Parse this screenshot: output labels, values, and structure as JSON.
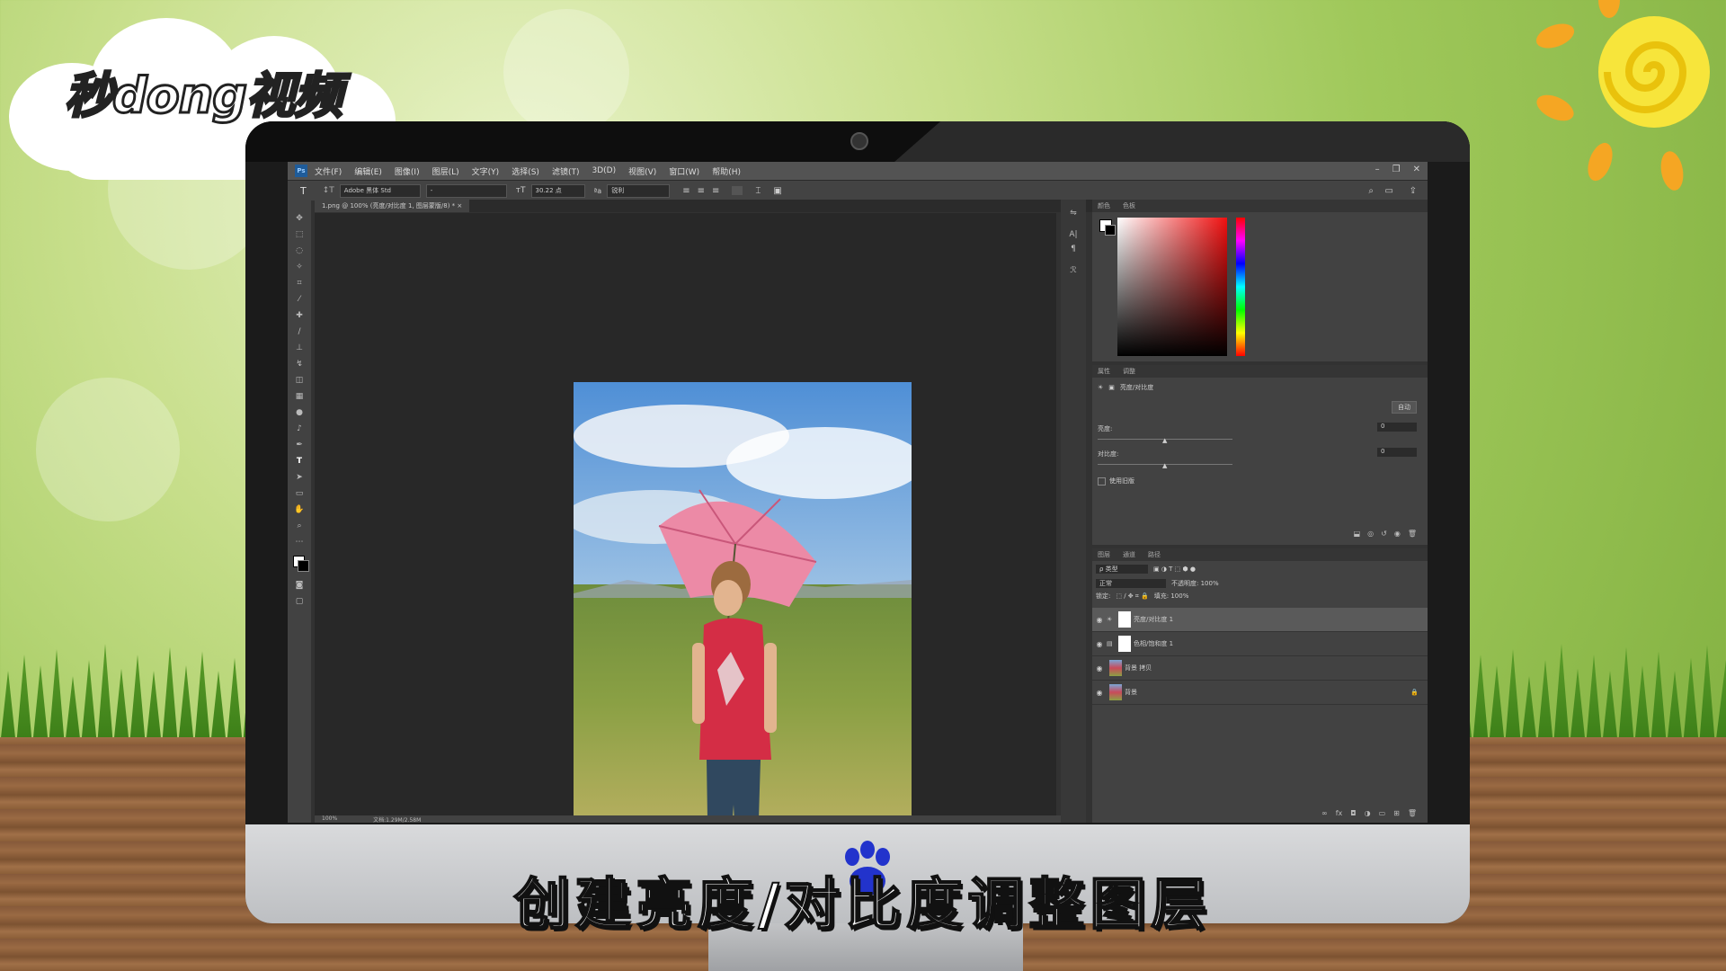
{
  "brand": {
    "logo_text": "秒dong视频"
  },
  "caption": "创建亮度/对比度调整图层",
  "app": {
    "menu": [
      "文件(F)",
      "编辑(E)",
      "图像(I)",
      "图层(L)",
      "文字(Y)",
      "选择(S)",
      "滤镜(T)",
      "3D(D)",
      "视图(V)",
      "窗口(W)",
      "帮助(H)"
    ],
    "options": {
      "font_family": "Adobe 黑体 Std",
      "font_style": "-",
      "font_size": "30.22 点",
      "antialias": "锐利"
    },
    "doc_tab": "1.png @ 100% (亮度/对比度 1, 图层蒙版/8) * ×",
    "status": {
      "zoom": "100%",
      "doc_size": "文档:1.29M/2.58M"
    }
  },
  "color_panel": {
    "tabs": [
      "颜色",
      "色板"
    ]
  },
  "properties": {
    "tabs": [
      "属性",
      "调整"
    ],
    "title": "亮度/对比度",
    "auto_label": "自动",
    "brightness_label": "亮度:",
    "brightness_value": "0",
    "contrast_label": "对比度:",
    "contrast_value": "0",
    "legacy_label": "使用旧版"
  },
  "layers_panel": {
    "tabs": [
      "图层",
      "通道",
      "路径"
    ],
    "filter_label": "ρ 类型",
    "blend_mode": "正常",
    "opacity_label": "不透明度: 100%",
    "lock_label": "锁定:",
    "fill_label": "填充: 100%",
    "layers": [
      {
        "name": "亮度/对比度 1",
        "selected": true
      },
      {
        "name": "色相/饱和度 1",
        "selected": false
      },
      {
        "name": "背景 拷贝",
        "selected": false
      },
      {
        "name": "背景",
        "selected": false
      }
    ]
  },
  "colors": {
    "ps_bg": "#323232",
    "panel": "#424242",
    "accent": "#1f5c9a"
  }
}
